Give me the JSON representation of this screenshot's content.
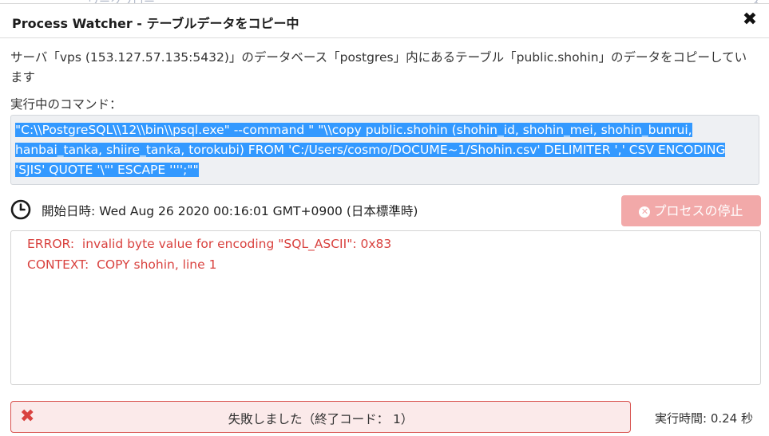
{
  "dialog": {
    "title": "Process Watcher - テーブルデータをコピー中",
    "description": "サーバ「vps (153.127.57.135:5432)」のデータベース「postgres」内にあるテーブル「public.shohin」のデータをコピーしています",
    "command_label": "実行中のコマンド：",
    "command": "\"C:\\\\PostgreSQL\\\\12\\\\bin\\\\psql.exe\" --command \" \"\\\\copy public.shohin (shohin_id, shohin_mei, shohin_bunrui, hanbai_tanka, shiire_tanka, torokubi) FROM 'C:/Users/cosmo/DOCUME~1/Shohin.csv' DELIMITER ',' CSV ENCODING 'SJIS' QUOTE '\\\"' ESCAPE '''';\"\"",
    "start_time_text": "開始日時: Wed Aug 26 2020 00:16:01 GMT+0900 (日本標準時)",
    "stop_button_label": "プロセスの停止",
    "log_lines": [
      "ERROR:  invalid byte value for encoding \"SQL_ASCII\": 0x83",
      "CONTEXT:  COPY shohin, line 1"
    ],
    "status_text": "失敗しました（終了コード： 1）",
    "elapsed_text": "実行時間: 0.24 秒"
  },
  "colors": {
    "error": "#d9423f",
    "selection": "#3399ff",
    "stop_button_disabled": "#f2a9a9",
    "status_bg": "#fbeaea"
  },
  "icons": {
    "close": "close-icon",
    "clock": "clock-icon",
    "stop": "times-circle-icon",
    "failure": "times-icon"
  }
}
